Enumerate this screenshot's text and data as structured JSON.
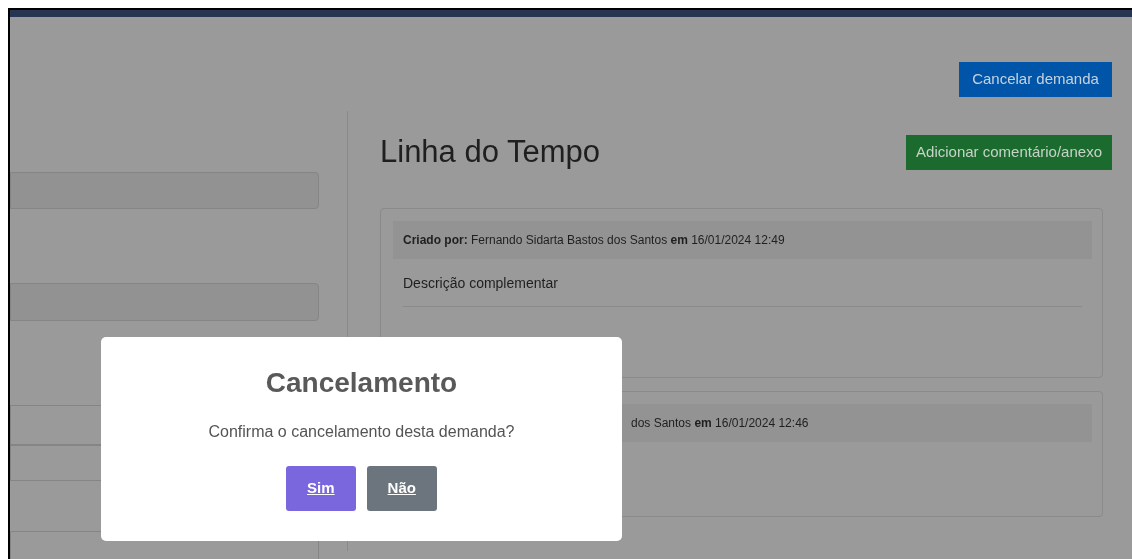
{
  "header": {
    "cancel_button": "Cancelar demanda"
  },
  "timeline": {
    "title": "Linha do Tempo",
    "add_button": "Adicionar comentário/anexo",
    "entries": [
      {
        "header": "**Criado por:** Fernando Sidarta Bastos dos Santos **em** 16/01/2024 12:49",
        "body": "Descrição complementar"
      },
      {
        "header": "dos Santos **em** 16/01/2024 12:46"
      }
    ]
  },
  "dialog": {
    "title": "Cancelamento",
    "message": "Confirma o cancelamento desta demanda?",
    "buttons": [
      {
        "label": "Sim",
        "kind": "primary"
      },
      {
        "label": "Não",
        "kind": "secondary"
      }
    ]
  }
}
